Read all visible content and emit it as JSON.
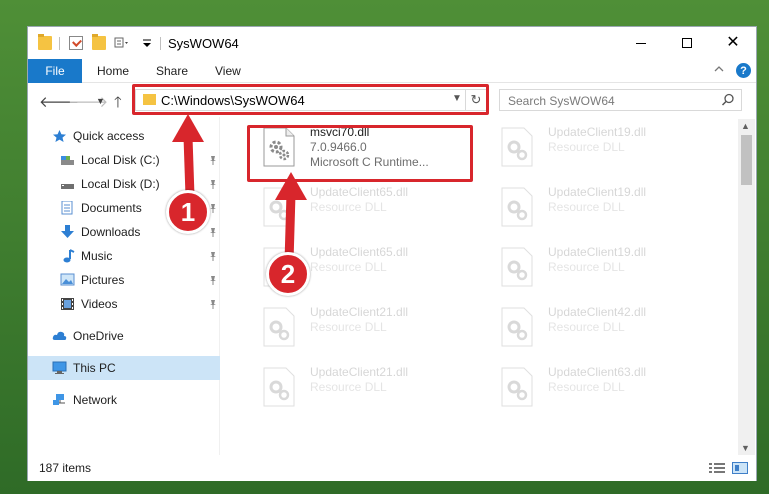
{
  "window": {
    "title": "SysWOW64"
  },
  "ribbon": {
    "file_tab": "File",
    "tabs": [
      "Home",
      "Share",
      "View"
    ],
    "help": "?"
  },
  "address": {
    "path": "C:\\Windows\\SysWOW64",
    "search_placeholder": "Search SysWOW64"
  },
  "sidebar": {
    "quick_access": "Quick access",
    "items": [
      {
        "label": "Local Disk (C:)",
        "icon": "drive-icon",
        "pinned": true
      },
      {
        "label": "Local Disk (D:)",
        "icon": "drive-icon",
        "pinned": true
      },
      {
        "label": "Documents",
        "icon": "documents-icon",
        "pinned": true
      },
      {
        "label": "Downloads",
        "icon": "downloads-icon",
        "pinned": true
      },
      {
        "label": "Music",
        "icon": "music-icon",
        "pinned": true
      },
      {
        "label": "Pictures",
        "icon": "pictures-icon",
        "pinned": true
      },
      {
        "label": "Videos",
        "icon": "videos-icon",
        "pinned": true
      }
    ],
    "onedrive": "OneDrive",
    "this_pc": "This PC",
    "network": "Network"
  },
  "files": {
    "selected": {
      "name": "msvci70.dll",
      "version": "7.0.9466.0",
      "description": "Microsoft C Runtime..."
    },
    "background": [
      {
        "name": "UpdateClient19.dll",
        "type": "Resource DLL"
      },
      {
        "name": "UpdateClient65.dll",
        "type": "Resource DLL"
      },
      {
        "name": "UpdateClient19.dll",
        "type": "Resource DLL"
      },
      {
        "name": "UpdateClient65.dll",
        "type": "Resource DLL"
      },
      {
        "name": "UpdateClient19.dll",
        "type": "Resource DLL"
      },
      {
        "name": "UpdateClient21.dll",
        "type": "Resource DLL"
      },
      {
        "name": "UpdateClient42.dll",
        "type": "Resource DLL"
      },
      {
        "name": "UpdateClient21.dll",
        "type": "Resource DLL"
      },
      {
        "name": "UpdateClient63.dll",
        "type": "Resource DLL"
      }
    ]
  },
  "status": {
    "item_count": "187 items"
  },
  "callouts": {
    "step1": "1",
    "step2": "2"
  },
  "colors": {
    "accent": "#1979ca",
    "highlight": "#d8262c",
    "selection": "#cce4f7"
  }
}
